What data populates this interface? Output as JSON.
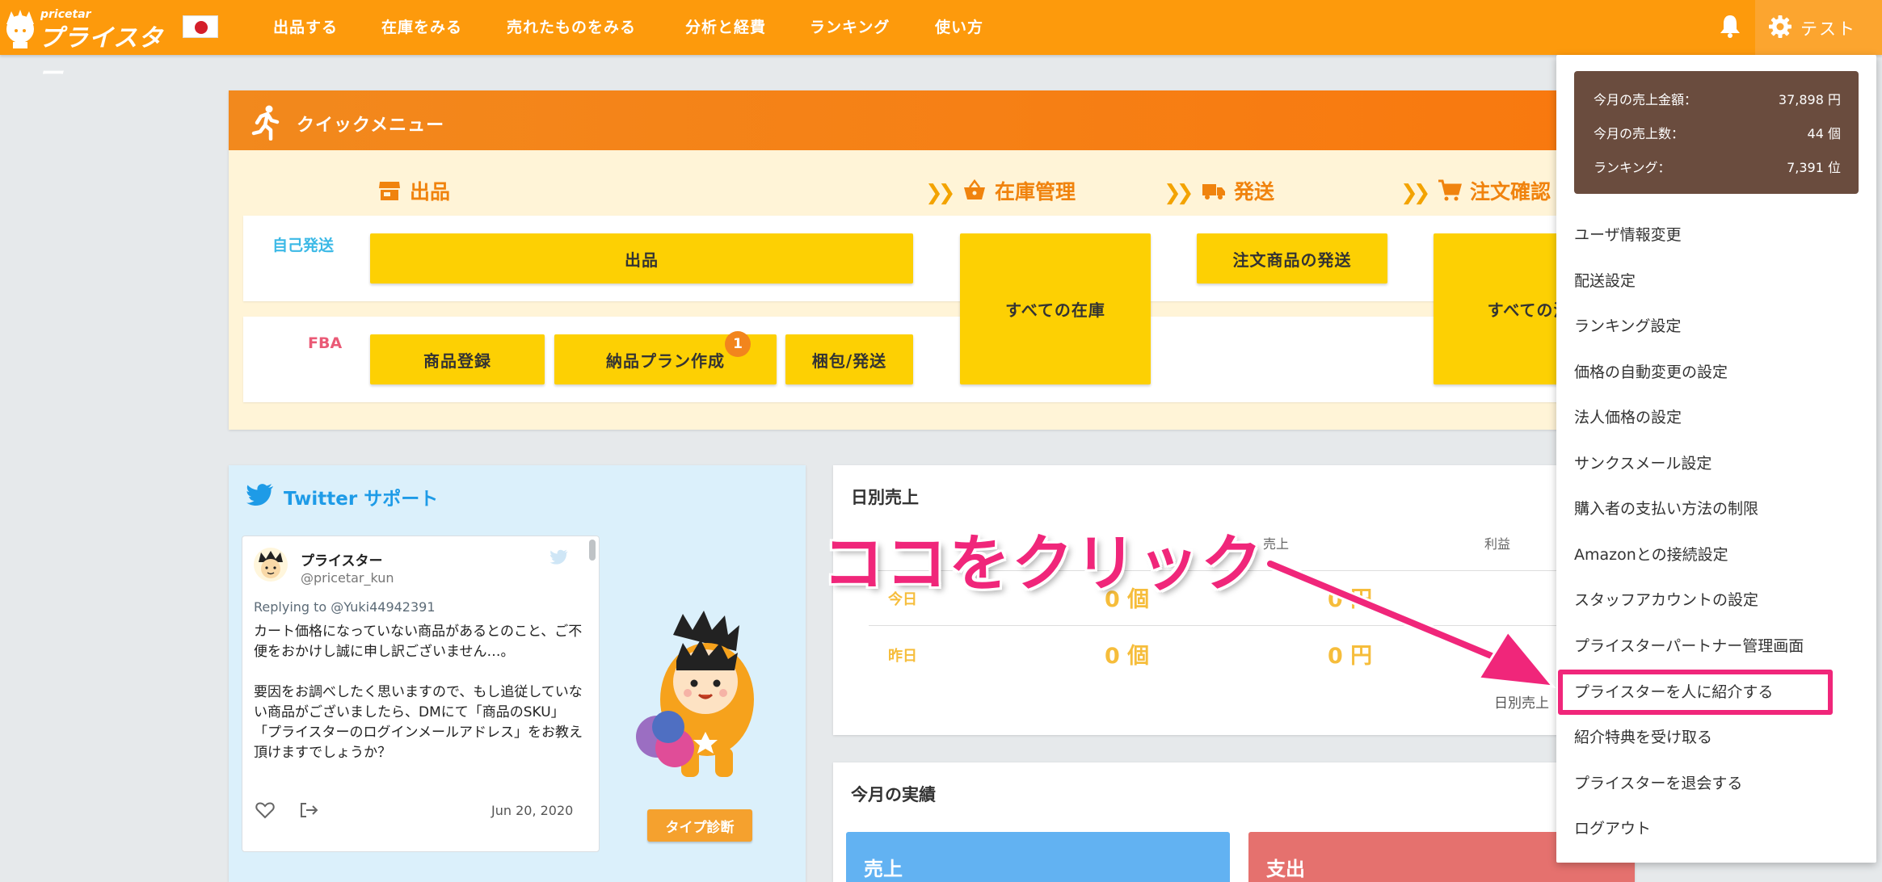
{
  "brand": {
    "logo_small": "pricetar",
    "logo_main": "プライスター"
  },
  "nav": {
    "items": [
      {
        "label": "出品する"
      },
      {
        "label": "在庫をみる"
      },
      {
        "label": "売れたものをみる"
      },
      {
        "label": "分析と経費"
      },
      {
        "label": "ランキング"
      },
      {
        "label": "使い方"
      }
    ]
  },
  "user": {
    "name": "テスト"
  },
  "quick_menu": {
    "title": "クイックメニュー",
    "sections": {
      "listing": "出品",
      "inventory": "在庫管理",
      "shipping": "発送",
      "orders": "注文確認"
    },
    "rows": {
      "self_ship": "自己発送",
      "fba": "FBA"
    },
    "buttons": {
      "listing": "出品",
      "all_inventory": "すべての在庫",
      "ship_orders": "注文商品の発送",
      "all_orders": "すべての注",
      "product_register": "商品登録",
      "plan_create": "納品プラン作成",
      "pack_ship": "梱包/発送"
    },
    "plan_badge": "1"
  },
  "twitter": {
    "title": "Twitter サポート",
    "name": "プライスター",
    "handle": "@pricetar_kun",
    "reply": "Replying to @Yuki44942391",
    "text": "カート価格になっていない商品があるとのこと、ご不便をおかけし誠に申し訳ございません…。\n\n要因をお調べしたく思いますので、もし追従していない商品がございましたら、DMにて「商品のSKU」「プライスターのログインメールアドレス」をお教え頂けますでしょうか？",
    "date": "Jun 20, 2020",
    "type_button": "タイプ診断"
  },
  "daily_sales": {
    "title": "日別売上",
    "headers": {
      "sales": "売上",
      "profit": "利益"
    },
    "rows": [
      {
        "label": "今日",
        "count": "0 個",
        "sales": "0 円"
      },
      {
        "label": "昨日",
        "count": "0 個",
        "sales": "0 円"
      }
    ],
    "link": "日別売上"
  },
  "monthly": {
    "title": "今月の実績",
    "sales_label": "売上",
    "expense_label": "支出"
  },
  "dropdown": {
    "stats": [
      {
        "label": "今月の売上金額：",
        "value": "37,898 円"
      },
      {
        "label": "今月の売上数：",
        "value": "44 個"
      },
      {
        "label": "ランキング：",
        "value": "7,391 位"
      }
    ],
    "items": [
      "ユーザ情報変更",
      "配送設定",
      "ランキング設定",
      "価格の自動変更の設定",
      "法人価格の設定",
      "サンクスメール設定",
      "購入者の支払い方法の制限",
      "Amazonとの接続設定",
      "スタッフアカウントの設定",
      "プライスターパートナー管理画面",
      "プライスターを人に紹介する",
      "紹介特典を受け取る",
      "プライスターを退会する",
      "ログアウト"
    ]
  },
  "annotation": {
    "callout": "ココをクリック"
  },
  "colors": {
    "topbar": "#fd9a0c",
    "accent_pink": "#f0267a",
    "button_yellow": "#fdd003",
    "stats_brown": "#6a4c3e"
  }
}
